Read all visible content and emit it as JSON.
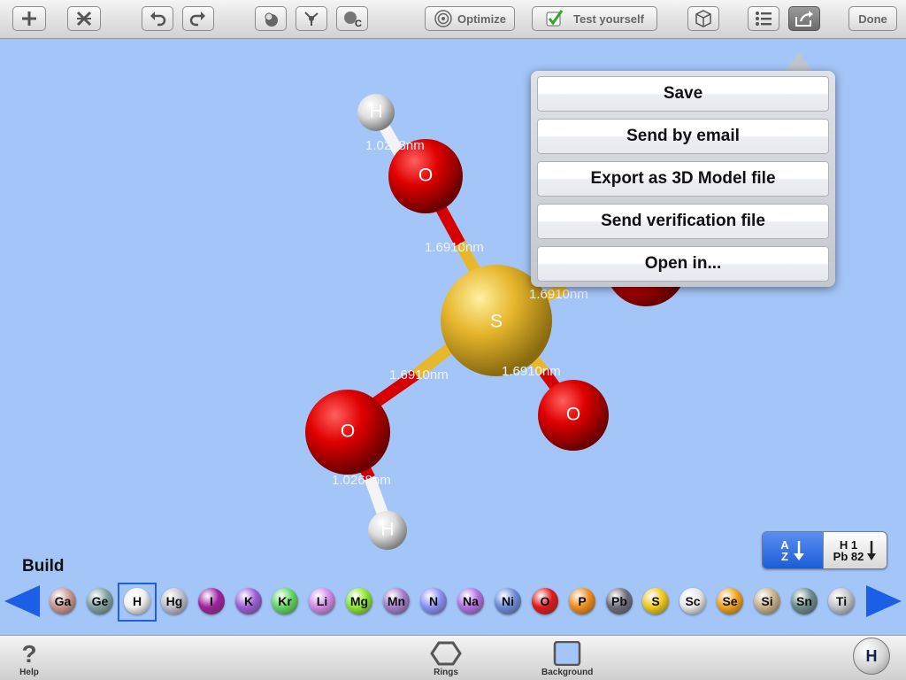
{
  "toolbar": {
    "buttons": [
      {
        "name": "add-button",
        "icon": "plus-icon"
      },
      {
        "name": "delete-button",
        "icon": "cross-icon"
      },
      {
        "name": "undo-button",
        "icon": "undo-icon"
      },
      {
        "name": "redo-button",
        "icon": "redo-icon"
      },
      {
        "name": "atom-style-button",
        "icon": "atom-icon"
      },
      {
        "name": "bond-style-button",
        "icon": "bond-icon"
      },
      {
        "name": "carbon-button",
        "icon": "carbon-icon"
      }
    ],
    "optimize_label": "Optimize",
    "test_label": "Test yourself",
    "done_label": "Done"
  },
  "share_menu": {
    "items": [
      "Save",
      "Send by email",
      "Export as 3D Model file",
      "Send verification file",
      "Open in..."
    ]
  },
  "molecule": {
    "atoms": [
      {
        "id": "S",
        "label": "S",
        "color": "#e8b82c"
      },
      {
        "id": "O1",
        "label": "O",
        "color": "#d10000"
      },
      {
        "id": "O2",
        "label": "O",
        "color": "#d10000"
      },
      {
        "id": "O3",
        "label": "O",
        "color": "#d10000"
      },
      {
        "id": "O4",
        "label": "",
        "color": "#d10000"
      },
      {
        "id": "H1",
        "label": "H",
        "color": "#e8e8e8"
      },
      {
        "id": "H2",
        "label": "H",
        "color": "#e8e8e8"
      }
    ],
    "bond_labels": [
      "1.0268nm",
      "1.6910nm",
      "1.6910nm",
      "1.6910nm",
      "1.6910nm",
      "1.0268nm"
    ]
  },
  "build_label": "Build",
  "sort": {
    "az_top": "A",
    "az_bottom": "Z",
    "num_top": "H 1",
    "num_bottom": "Pb 82"
  },
  "elements": [
    {
      "symbol": "Ga",
      "color": "#c8958e"
    },
    {
      "symbol": "Ge",
      "color": "#7fa0a0"
    },
    {
      "symbol": "H",
      "color": "#f0f0f0",
      "selected": true
    },
    {
      "symbol": "Hg",
      "color": "#c0c0cc"
    },
    {
      "symbol": "I",
      "color": "#a020a0"
    },
    {
      "symbol": "K",
      "color": "#9b5cd6"
    },
    {
      "symbol": "Kr",
      "color": "#5fd75f"
    },
    {
      "symbol": "Li",
      "color": "#d08ae6"
    },
    {
      "symbol": "Mg",
      "color": "#8ae62e"
    },
    {
      "symbol": "Mn",
      "color": "#a27ec9"
    },
    {
      "symbol": "N",
      "color": "#8a8ff2"
    },
    {
      "symbol": "Na",
      "color": "#b06fe0"
    },
    {
      "symbol": "Ni",
      "color": "#6a8ad8"
    },
    {
      "symbol": "O",
      "color": "#e01818"
    },
    {
      "symbol": "P",
      "color": "#f08a1a"
    },
    {
      "symbol": "Pb",
      "color": "#6c6c7a"
    },
    {
      "symbol": "S",
      "color": "#f0c81a"
    },
    {
      "symbol": "Sc",
      "color": "#e6e6e6"
    },
    {
      "symbol": "Se",
      "color": "#f0a01a"
    },
    {
      "symbol": "Si",
      "color": "#c8b08a"
    },
    {
      "symbol": "Sn",
      "color": "#6a8a8a"
    },
    {
      "symbol": "Ti",
      "color": "#c0c4c8"
    }
  ],
  "bottom": {
    "help_label": "Help",
    "rings_label": "Rings",
    "background_label": "Background",
    "current_element": "H"
  }
}
